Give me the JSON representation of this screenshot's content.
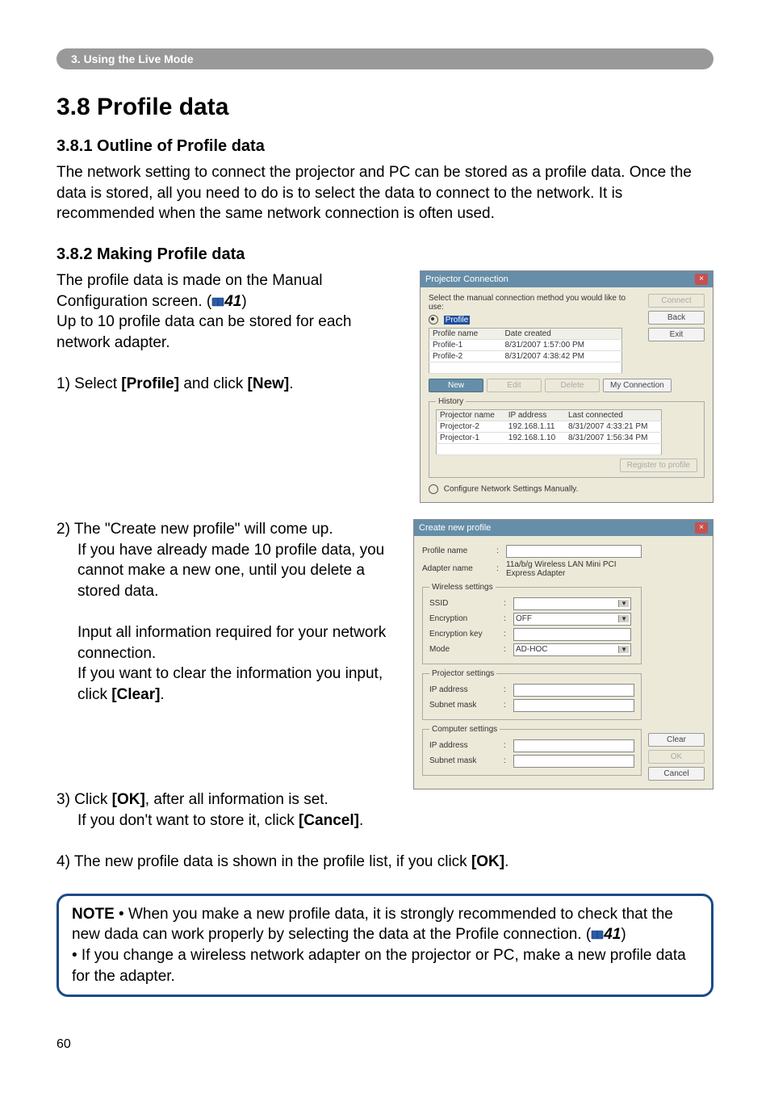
{
  "header": {
    "chapter": "3. Using the Live Mode"
  },
  "h1": "3.8 Profile data",
  "s381": {
    "title": "3.8.1 Outline of Profile data",
    "p1": "The network setting to connect the projector and PC can be stored as a profile data. Once the data is stored, all you need to do is to select the data to connect to the network. It is recommended when the same network connection is often used."
  },
  "s382": {
    "title": "3.8.2 Making Profile data",
    "p1a": "The profile data is made on the Manual Configuration screen. (",
    "ref1": "41",
    "p1b": ")",
    "p1c": "Up to 10 profile data can be stored for each network adapter.",
    "step1a": "1) Select ",
    "step1b": "[Profile]",
    "step1c": " and click ",
    "step1d": "[New]",
    "step1e": ".",
    "step2a": "2) The \"Create new profile\" will come up.",
    "step2b": "If you have already made 10 profile data, you cannot make a new one, until you delete a stored data.",
    "step2c": "Input all information required for your network connection.",
    "step2d": "If you want to clear the information you input, click ",
    "step2e": "[Clear]",
    "step2f": ".",
    "step3a": "3) Click ",
    "step3b": "[OK]",
    "step3c": ", after all information is set.",
    "step3d": "If you don't want to store it, click ",
    "step3e": "[Cancel]",
    "step3f": ".",
    "step4a": "4) The new profile data is shown in the profile list, if you click ",
    "step4b": "[OK]",
    "step4c": "."
  },
  "note": {
    "label": "NOTE",
    "p1": " • When you make a new profile data, it is strongly recommended to check that the new dada can work properly by selecting the data at the Profile connection. (",
    "ref": "41",
    "p1b": ")",
    "p2": "• If you change a wireless network adapter on the projector or PC, make a new profile data for the adapter."
  },
  "pageNum": "60",
  "dlg1": {
    "title": "Projector Connection",
    "topline": "Select the manual connection method you would like to use:",
    "profileLabel": "Profile",
    "btnConnect": "Connect",
    "btnBack": "Back",
    "btnExit": "Exit",
    "col1": "Profile name",
    "col2": "Date created",
    "rows": [
      {
        "name": "Profile-1",
        "date": "8/31/2007 1:57:00 PM"
      },
      {
        "name": "Profile-2",
        "date": "8/31/2007 4:38:42 PM"
      }
    ],
    "btnNew": "New",
    "btnEdit": "Edit",
    "btnDelete": "Delete",
    "btnMyConn": "My Connection",
    "historyLegend": "History",
    "hcol1": "Projector name",
    "hcol2": "IP address",
    "hcol3": "Last connected",
    "hrows": [
      {
        "pj": "Projector-2",
        "ip": "192.168.1.11",
        "last": "8/31/2007 4:33:21 PM"
      },
      {
        "pj": "Projector-1",
        "ip": "192.168.1.10",
        "last": "8/31/2007 1:56:34 PM"
      }
    ],
    "btnRegister": "Register to profile",
    "cfgLine": "Configure Network Settings Manually."
  },
  "dlg2": {
    "title": "Create new profile",
    "profileName": "Profile name",
    "adapterName": "Adapter name",
    "adapterVal": "11a/b/g Wireless LAN Mini PCI Express Adapter",
    "wlLegend": "Wireless settings",
    "ssid": "SSID",
    "enc": "Encryption",
    "encVal": "OFF",
    "encKey": "Encryption key",
    "mode": "Mode",
    "modeVal": "AD-HOC",
    "pjLegend": "Projector settings",
    "ip": "IP address",
    "subnet": "Subnet mask",
    "cpLegend": "Computer settings",
    "btnClear": "Clear",
    "btnOk": "OK",
    "btnCancel": "Cancel"
  }
}
